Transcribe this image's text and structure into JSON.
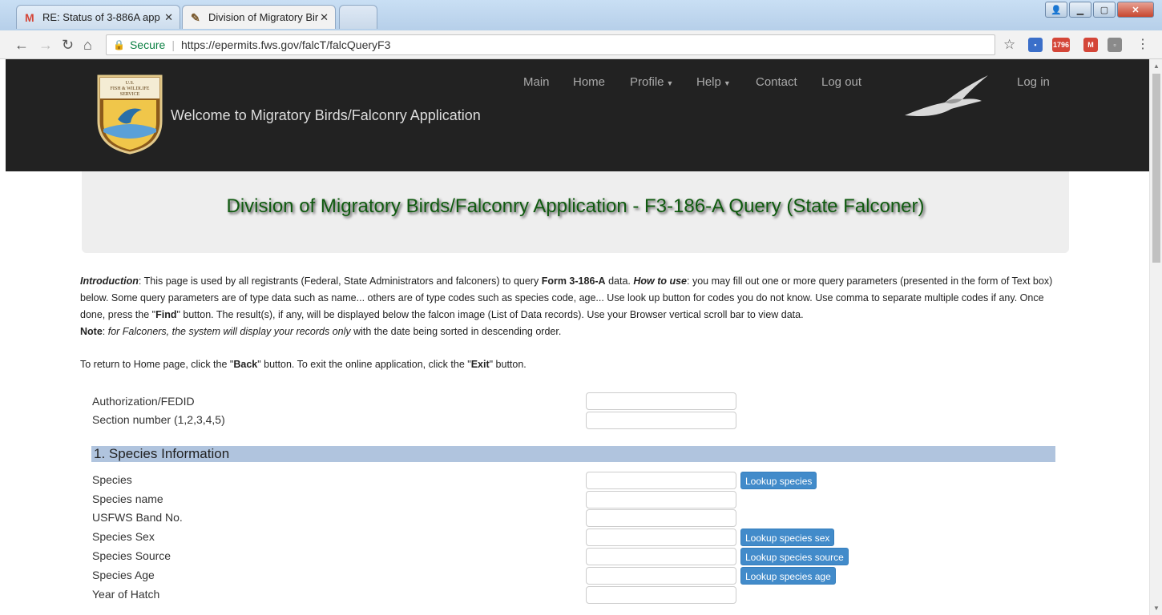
{
  "browser": {
    "tabs": [
      {
        "title": "RE: Status of 3-886A app",
        "icon": "gmail-icon",
        "active": false
      },
      {
        "title": "Division of Migratory Bir",
        "icon": "falcon-favicon-icon",
        "active": true
      }
    ],
    "secure_label": "Secure",
    "url": "https://epermits.fws.gov/falcT/falcQueryF3",
    "gmail_count": "1796"
  },
  "header": {
    "logo_text_line1": "U.S.",
    "logo_text_line2": "FISH & WILDLIFE",
    "logo_text_line3": "SERVICE",
    "welcome": "Welcome to Migratory Birds/Falconry Application",
    "nav": [
      "Main",
      "Home",
      "Profile",
      "Help",
      "Contact",
      "Log out"
    ],
    "login": "Log in"
  },
  "page_title": "Division of Migratory Birds/Falconry Application - F3-186-A Query (State Falconer)",
  "intro": {
    "intro_label": "Introduction",
    "p1": ": This page is used by all registrants (Federal, State Administrators and falconers) to query ",
    "form_name": "Form 3-186-A",
    "p2": " data. ",
    "how_label": "How to use",
    "p3": ": you may fill out one or more query parameters (presented in the form of Text box) below. Some query parameters are of type data such as name... others are of type codes such as species code, age... Use look up button for codes you do not know. Use comma to separate multiple codes if any. Once done, press the \"",
    "find": "Find",
    "p4": "\" button. The result(s), if any, will be displayed below the falcon image (List of Data records). Use your Browser vertical scroll bar to view data.",
    "note_label": "Note",
    "p5": ": ",
    "note_italic": "for Falconers, the system will display your records only",
    "p6": " with the date being sorted in descending order.",
    "return_p1": "To return to Home page, click the \"",
    "back": "Back",
    "return_p2": "\" button. To exit the online application, click the \"",
    "exit": "Exit",
    "return_p3": "\" button."
  },
  "form": {
    "top_fields": [
      "Authorization/FEDID",
      "Section number (1,2,3,4,5)"
    ],
    "section1_title": "1. Species Information",
    "species_fields": [
      "Species",
      "Species name",
      "USFWS Band No.",
      "Species Sex",
      "Species Source",
      "Species Age",
      "Year of Hatch"
    ],
    "lookup_species": "Lookup species",
    "lookup_sex": "Lookup species sex",
    "lookup_source": "Lookup species source",
    "lookup_age": "Lookup species age"
  }
}
